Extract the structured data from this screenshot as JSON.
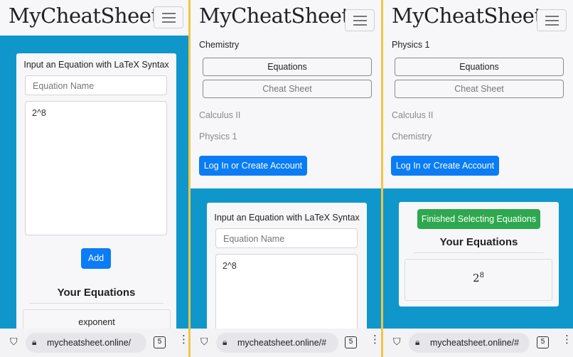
{
  "brand": {
    "logo_text": "MyCheatSheet"
  },
  "panel1": {
    "card_title": "Input an Equation with LaTeX Syntax",
    "equation_name_placeholder": "Equation Name",
    "latex_value": "2^8",
    "add_label": "Add",
    "your_equations_title": "Your Equations",
    "equation_item": "exponent",
    "url": "mycheatsheet.online/",
    "tab_count": "5"
  },
  "panel2": {
    "active_subject": "Chemistry",
    "equations_label": "Equations",
    "cheat_sheet_label": "Cheat Sheet",
    "subjects": [
      "Calculus II",
      "Physics 1"
    ],
    "login_label": "Log In or Create Account",
    "card_title": "Input an Equation with LaTeX Syntax",
    "equation_name_placeholder": "Equation Name",
    "latex_value": "2^8",
    "url": "mycheatsheet.online/#",
    "tab_count": "5"
  },
  "panel3": {
    "active_subject": "Physics 1",
    "equations_label": "Equations",
    "cheat_sheet_label": "Cheat Sheet",
    "subjects": [
      "Calculus II",
      "Chemistry"
    ],
    "login_label": "Log In or Create Account",
    "finished_label": "Finished Selecting Equations",
    "your_equations_title": "Your Equations",
    "rendered_base": "2",
    "rendered_exponent": "8",
    "url": "mycheatsheet.online/#",
    "tab_count": "5"
  },
  "icons": {
    "menu": "hamburger-menu-icon",
    "shield": "shield-icon",
    "lock": "lock-icon",
    "more": "more-vertical-icon"
  },
  "colors": {
    "divider": "#f4c542",
    "hero_blue": "#0f97cc",
    "primary_button": "#0a7cf5",
    "success_button": "#2ea84f"
  }
}
